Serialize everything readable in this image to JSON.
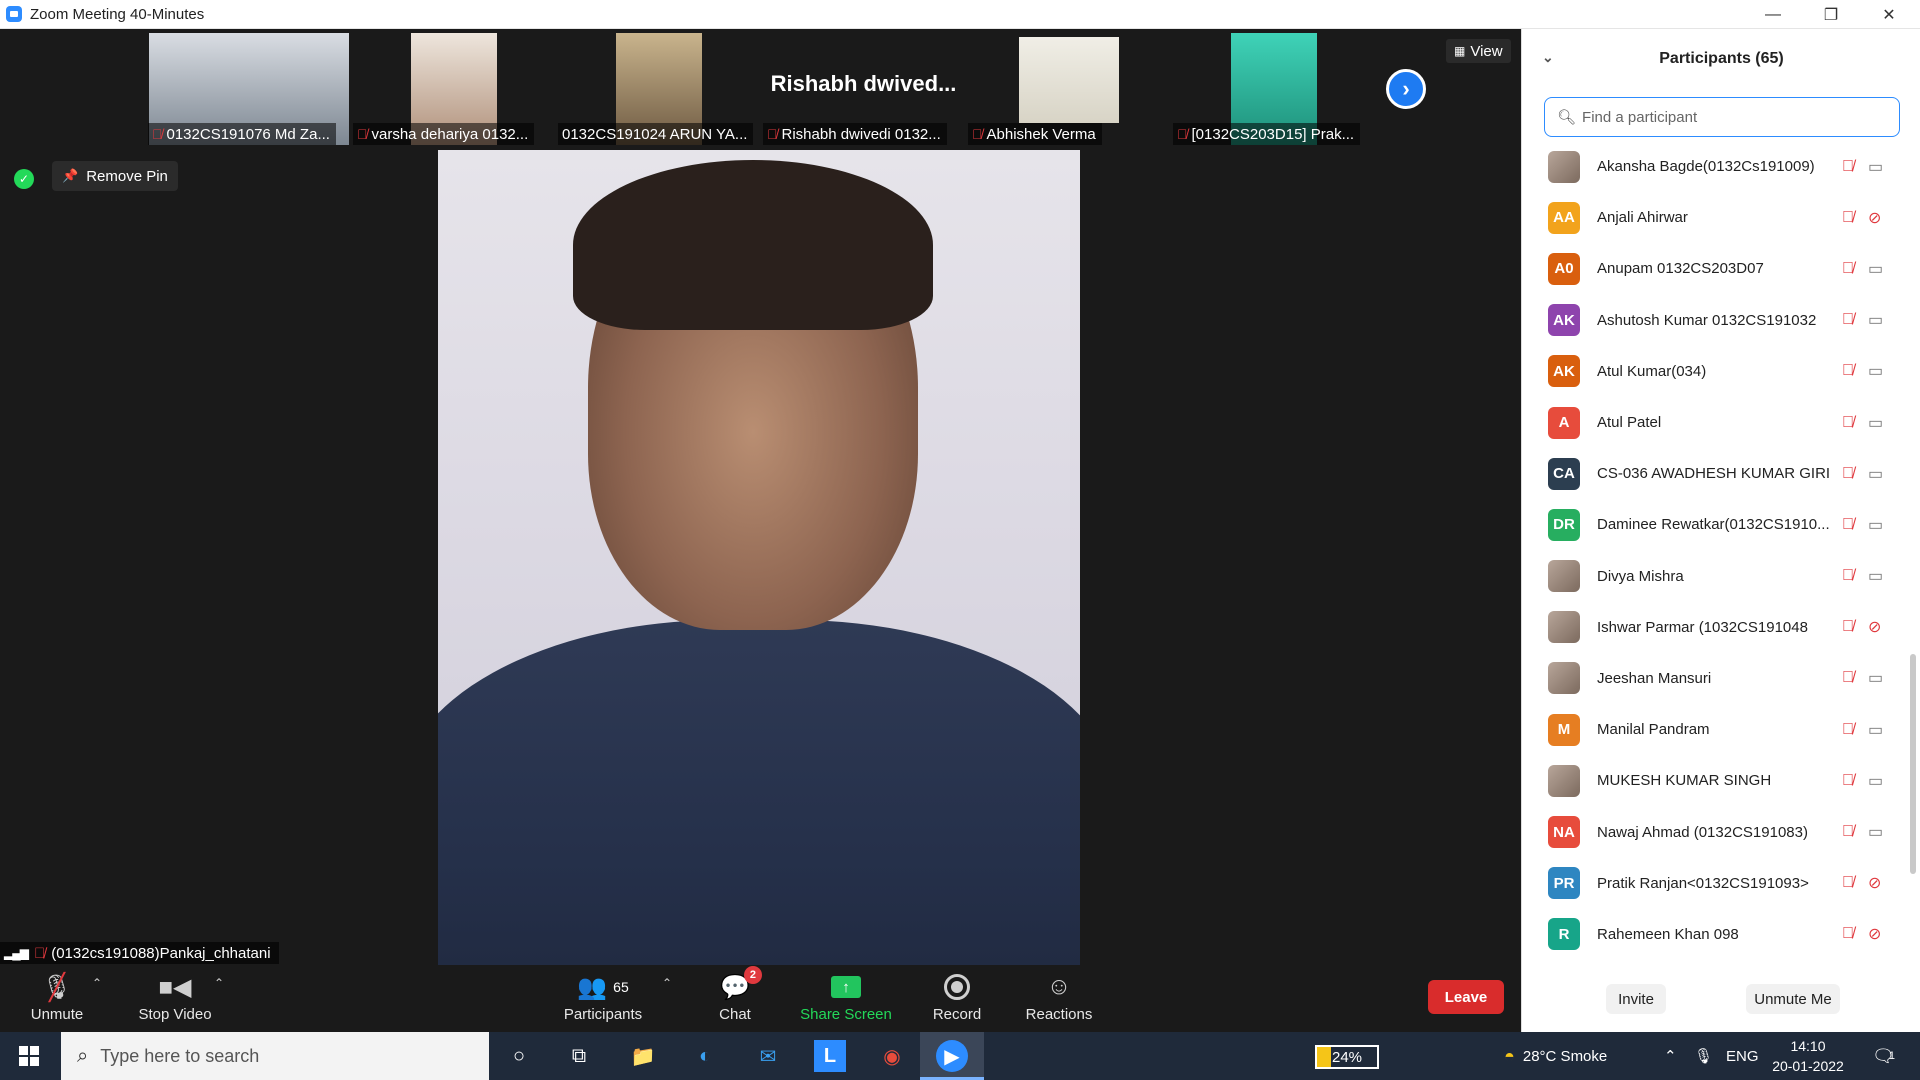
{
  "window": {
    "title": "Zoom Meeting 40-Minutes",
    "controls": [
      "—",
      "❐",
      "✕"
    ]
  },
  "strip": [
    {
      "name": "0132CS191076 Md Za...",
      "bg": "#8e9aa8",
      "muted": true
    },
    {
      "name": "varsha dehariya 0132...",
      "bg": "#c9b9a8",
      "muted": true
    },
    {
      "name": "0132CS191024 ARUN YA...",
      "bg": "#b7a583",
      "muted": false
    },
    {
      "name": "Rishabh dwivedi 0132...",
      "bigname": "Rishabh  dwived...",
      "muted": true
    },
    {
      "name": "Abhishek Verma",
      "bg": "#e7e4da",
      "muted": true
    },
    {
      "name": "[0132CS203D15] Prak...",
      "bg": "#35c2a8",
      "muted": true
    }
  ],
  "view_label": "View",
  "remove_pin_label": "Remove Pin",
  "speaker_label": "(0132cs191088)Pankaj_chhatani",
  "toolbar": {
    "unmute": "Unmute",
    "stop_video": "Stop Video",
    "participants": "Participants",
    "participants_count": "65",
    "chat": "Chat",
    "chat_badge": "2",
    "share_screen": "Share Screen",
    "record": "Record",
    "reactions": "Reactions",
    "leave": "Leave"
  },
  "panel": {
    "title": "Participants (65)",
    "search_placeholder": "Find a participant",
    "invite": "Invite",
    "unmute_me": "Unmute Me",
    "participants": [
      {
        "name": "Akansha Bagde(0132Cs191009)",
        "initials": "",
        "color": "photo",
        "cam_off": false
      },
      {
        "name": "Anjali Ahirwar",
        "initials": "AA",
        "color": "#f2a31c",
        "cam_off": true
      },
      {
        "name": "Anupam 0132CS203D07",
        "initials": "A0",
        "color": "#d95f0e",
        "cam_off": false
      },
      {
        "name": "Ashutosh Kumar 0132CS191032",
        "initials": "AK",
        "color": "#8e44ad",
        "cam_off": false
      },
      {
        "name": "Atul Kumar(034)",
        "initials": "AK",
        "color": "#d95f0e",
        "cam_off": false
      },
      {
        "name": "Atul Patel",
        "initials": "A",
        "color": "#e74c3c",
        "cam_off": false
      },
      {
        "name": "CS-036 AWADHESH KUMAR GIRI",
        "initials": "CA",
        "color": "#2c3e50",
        "cam_off": false
      },
      {
        "name": "Daminee Rewatkar(0132CS1910...",
        "initials": "DR",
        "color": "#27ae60",
        "cam_off": false
      },
      {
        "name": "Divya Mishra",
        "initials": "",
        "color": "photo",
        "cam_off": false
      },
      {
        "name": "Ishwar Parmar (1032CS191048",
        "initials": "",
        "color": "photo",
        "cam_off": true
      },
      {
        "name": "Jeeshan Mansuri",
        "initials": "",
        "color": "photo",
        "cam_off": false
      },
      {
        "name": "Manilal Pandram",
        "initials": "M",
        "color": "#e67e22",
        "cam_off": false
      },
      {
        "name": "MUKESH KUMAR SINGH",
        "initials": "",
        "color": "photo",
        "cam_off": false
      },
      {
        "name": "Nawaj Ahmad (0132CS191083)",
        "initials": "NA",
        "color": "#e74c3c",
        "cam_off": false
      },
      {
        "name": "Pratik Ranjan<0132CS191093>",
        "initials": "PR",
        "color": "#2e86c1",
        "cam_off": true
      },
      {
        "name": "Rahemeen Khan 098",
        "initials": "R",
        "color": "#17a589",
        "cam_off": true
      }
    ]
  },
  "taskbar": {
    "search_placeholder": "Type here to search",
    "battery": "24%",
    "battery_level": 0.24,
    "weather": "28°C  Smoke",
    "lang": "ENG",
    "time": "14:10",
    "date": "20-01-2022",
    "notif_count": "1"
  }
}
